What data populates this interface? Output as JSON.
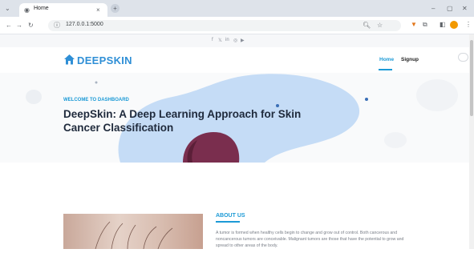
{
  "browser": {
    "tab_title": "Home",
    "new_tab_symbol": "+",
    "close_tab_symbol": "×",
    "url": "127.0.0.1:5000",
    "window_controls": [
      "–",
      "▢",
      "✕"
    ]
  },
  "site": {
    "social_icons": [
      "f",
      "𝕏",
      "in",
      "◎",
      "▶"
    ],
    "logo_text": "DEEPSKIN",
    "nav": {
      "home_label": "Home",
      "signup_label": "Signup"
    },
    "hero": {
      "welcome": "WELCOME TO DASHBOARD",
      "title": "DeepSkin: A Deep Learning Approach for Skin Cancer Classification"
    },
    "about": {
      "heading": "ABOUT US",
      "text": "A tumor is formed when healthy cells begin to change and grow out of control. Both cancerous and noncancerous tumors are conceivable. Malignant tumors are those that have the potential to grow and spread to other areas of the body."
    }
  },
  "colors": {
    "accent": "#1c9ad6",
    "logo": "#2f8fd6",
    "hero_blob": "#c5dcf6",
    "hair": "#7a2e4e"
  }
}
